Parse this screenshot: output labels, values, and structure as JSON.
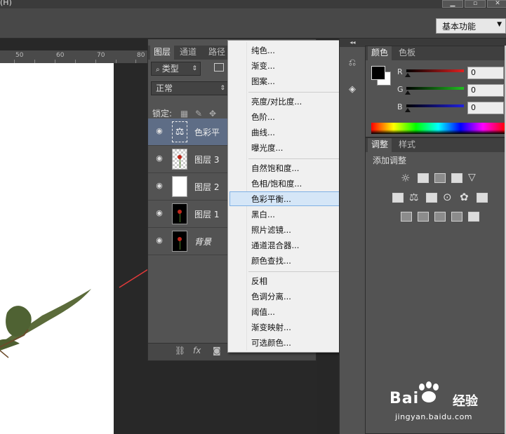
{
  "menubar": {
    "fragment": "(H)"
  },
  "workspace": {
    "label": "基本功能"
  },
  "ruler": {
    "ticks": [
      "50",
      "60",
      "70",
      "80"
    ]
  },
  "layers_panel": {
    "tabs": [
      "图层",
      "通道",
      "路径"
    ],
    "filter_kind": "类型",
    "blend_mode": "正常",
    "lock_label": "锁定:",
    "layers": [
      {
        "name": "色彩平",
        "type": "adjustment",
        "selected": true
      },
      {
        "name": "图层 3",
        "type": "transparent"
      },
      {
        "name": "图层 2",
        "type": "white"
      },
      {
        "name": "图层 1",
        "type": "rose"
      },
      {
        "name": "背景",
        "type": "rose",
        "name_obscured": true
      }
    ],
    "bottom_icons": [
      "link-icon",
      "fx-icon",
      "mask-icon"
    ]
  },
  "adjustment_menu": {
    "groups": [
      [
        "纯色...",
        "渐变...",
        "图案..."
      ],
      [
        "亮度/对比度...",
        "色阶...",
        "曲线...",
        "曝光度..."
      ],
      [
        "自然饱和度...",
        "色相/饱和度...",
        "色彩平衡...",
        "黑白...",
        "照片滤镜...",
        "通道混合器...",
        "颜色查找..."
      ],
      [
        "反相",
        "色调分离...",
        "阈值...",
        "渐变映射...",
        "可选颜色..."
      ]
    ],
    "highlighted": "色彩平衡..."
  },
  "color_panel": {
    "tabs": [
      "颜色",
      "色板"
    ],
    "channels": [
      {
        "label": "R",
        "value": "0",
        "color": "#e02020"
      },
      {
        "label": "G",
        "value": "0",
        "color": "#20c020"
      },
      {
        "label": "B",
        "value": "0",
        "color": "#2020e0"
      }
    ]
  },
  "adjustments_panel": {
    "tabs": [
      "调整",
      "样式"
    ],
    "add_label": "添加调整"
  },
  "watermark": {
    "brand": "Bai",
    "brand_suffix": "经验",
    "url": "jingyan.baidu.com"
  },
  "colors": {
    "menu_highlight": "#d5e6f7",
    "selected_layer": "#5e6d86",
    "arrow": "#e23a3a"
  }
}
